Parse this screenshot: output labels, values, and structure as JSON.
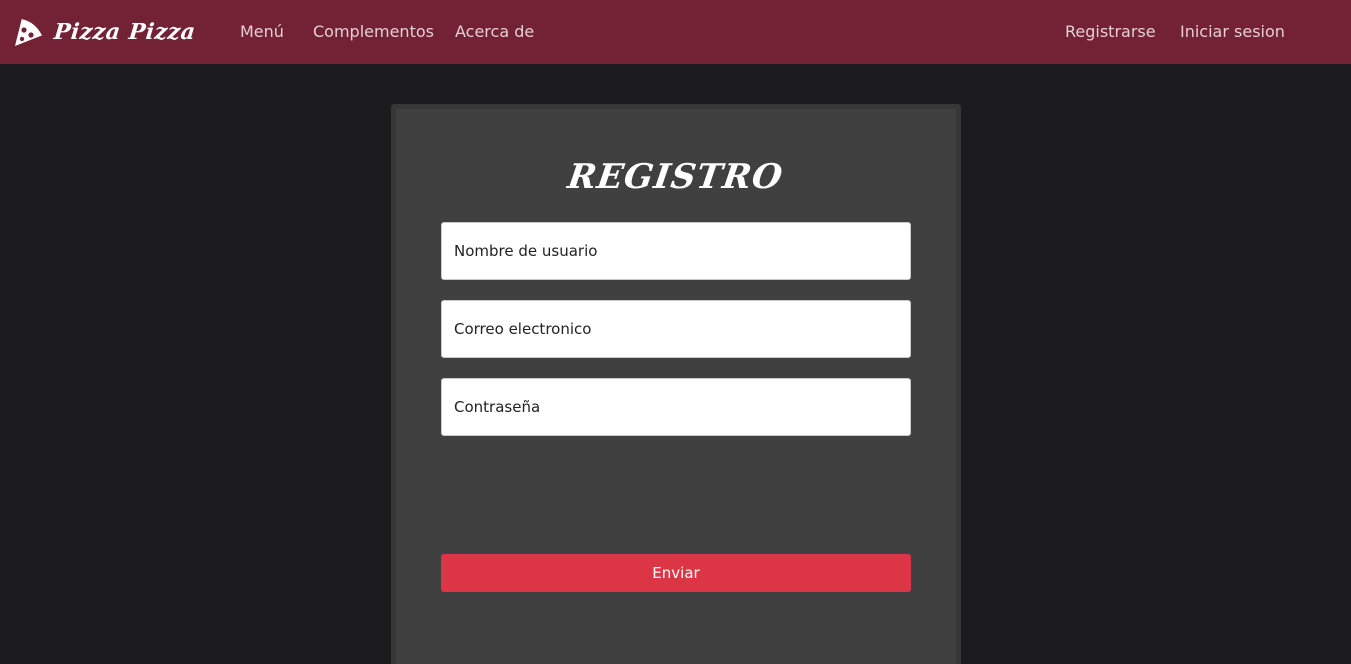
{
  "navbar": {
    "brand_name": "Pizza Pizza",
    "brand_icon": "pizza-slice-icon",
    "links": [
      {
        "label": "Menú"
      },
      {
        "label": "Complementos"
      },
      {
        "label": "Acerca de"
      }
    ],
    "auth": {
      "register_label": "Registrarse",
      "login_label": "Iniciar sesion"
    }
  },
  "form": {
    "title": "REGISTRO",
    "username_placeholder": "Nombre de usuario",
    "email_placeholder": "Correo electronico",
    "password_placeholder": "Contraseña",
    "submit_label": "Enviar"
  },
  "colors": {
    "navbar": "#722234",
    "background": "#1b1b1d",
    "card": "#404040",
    "submit": "#dc3545"
  }
}
